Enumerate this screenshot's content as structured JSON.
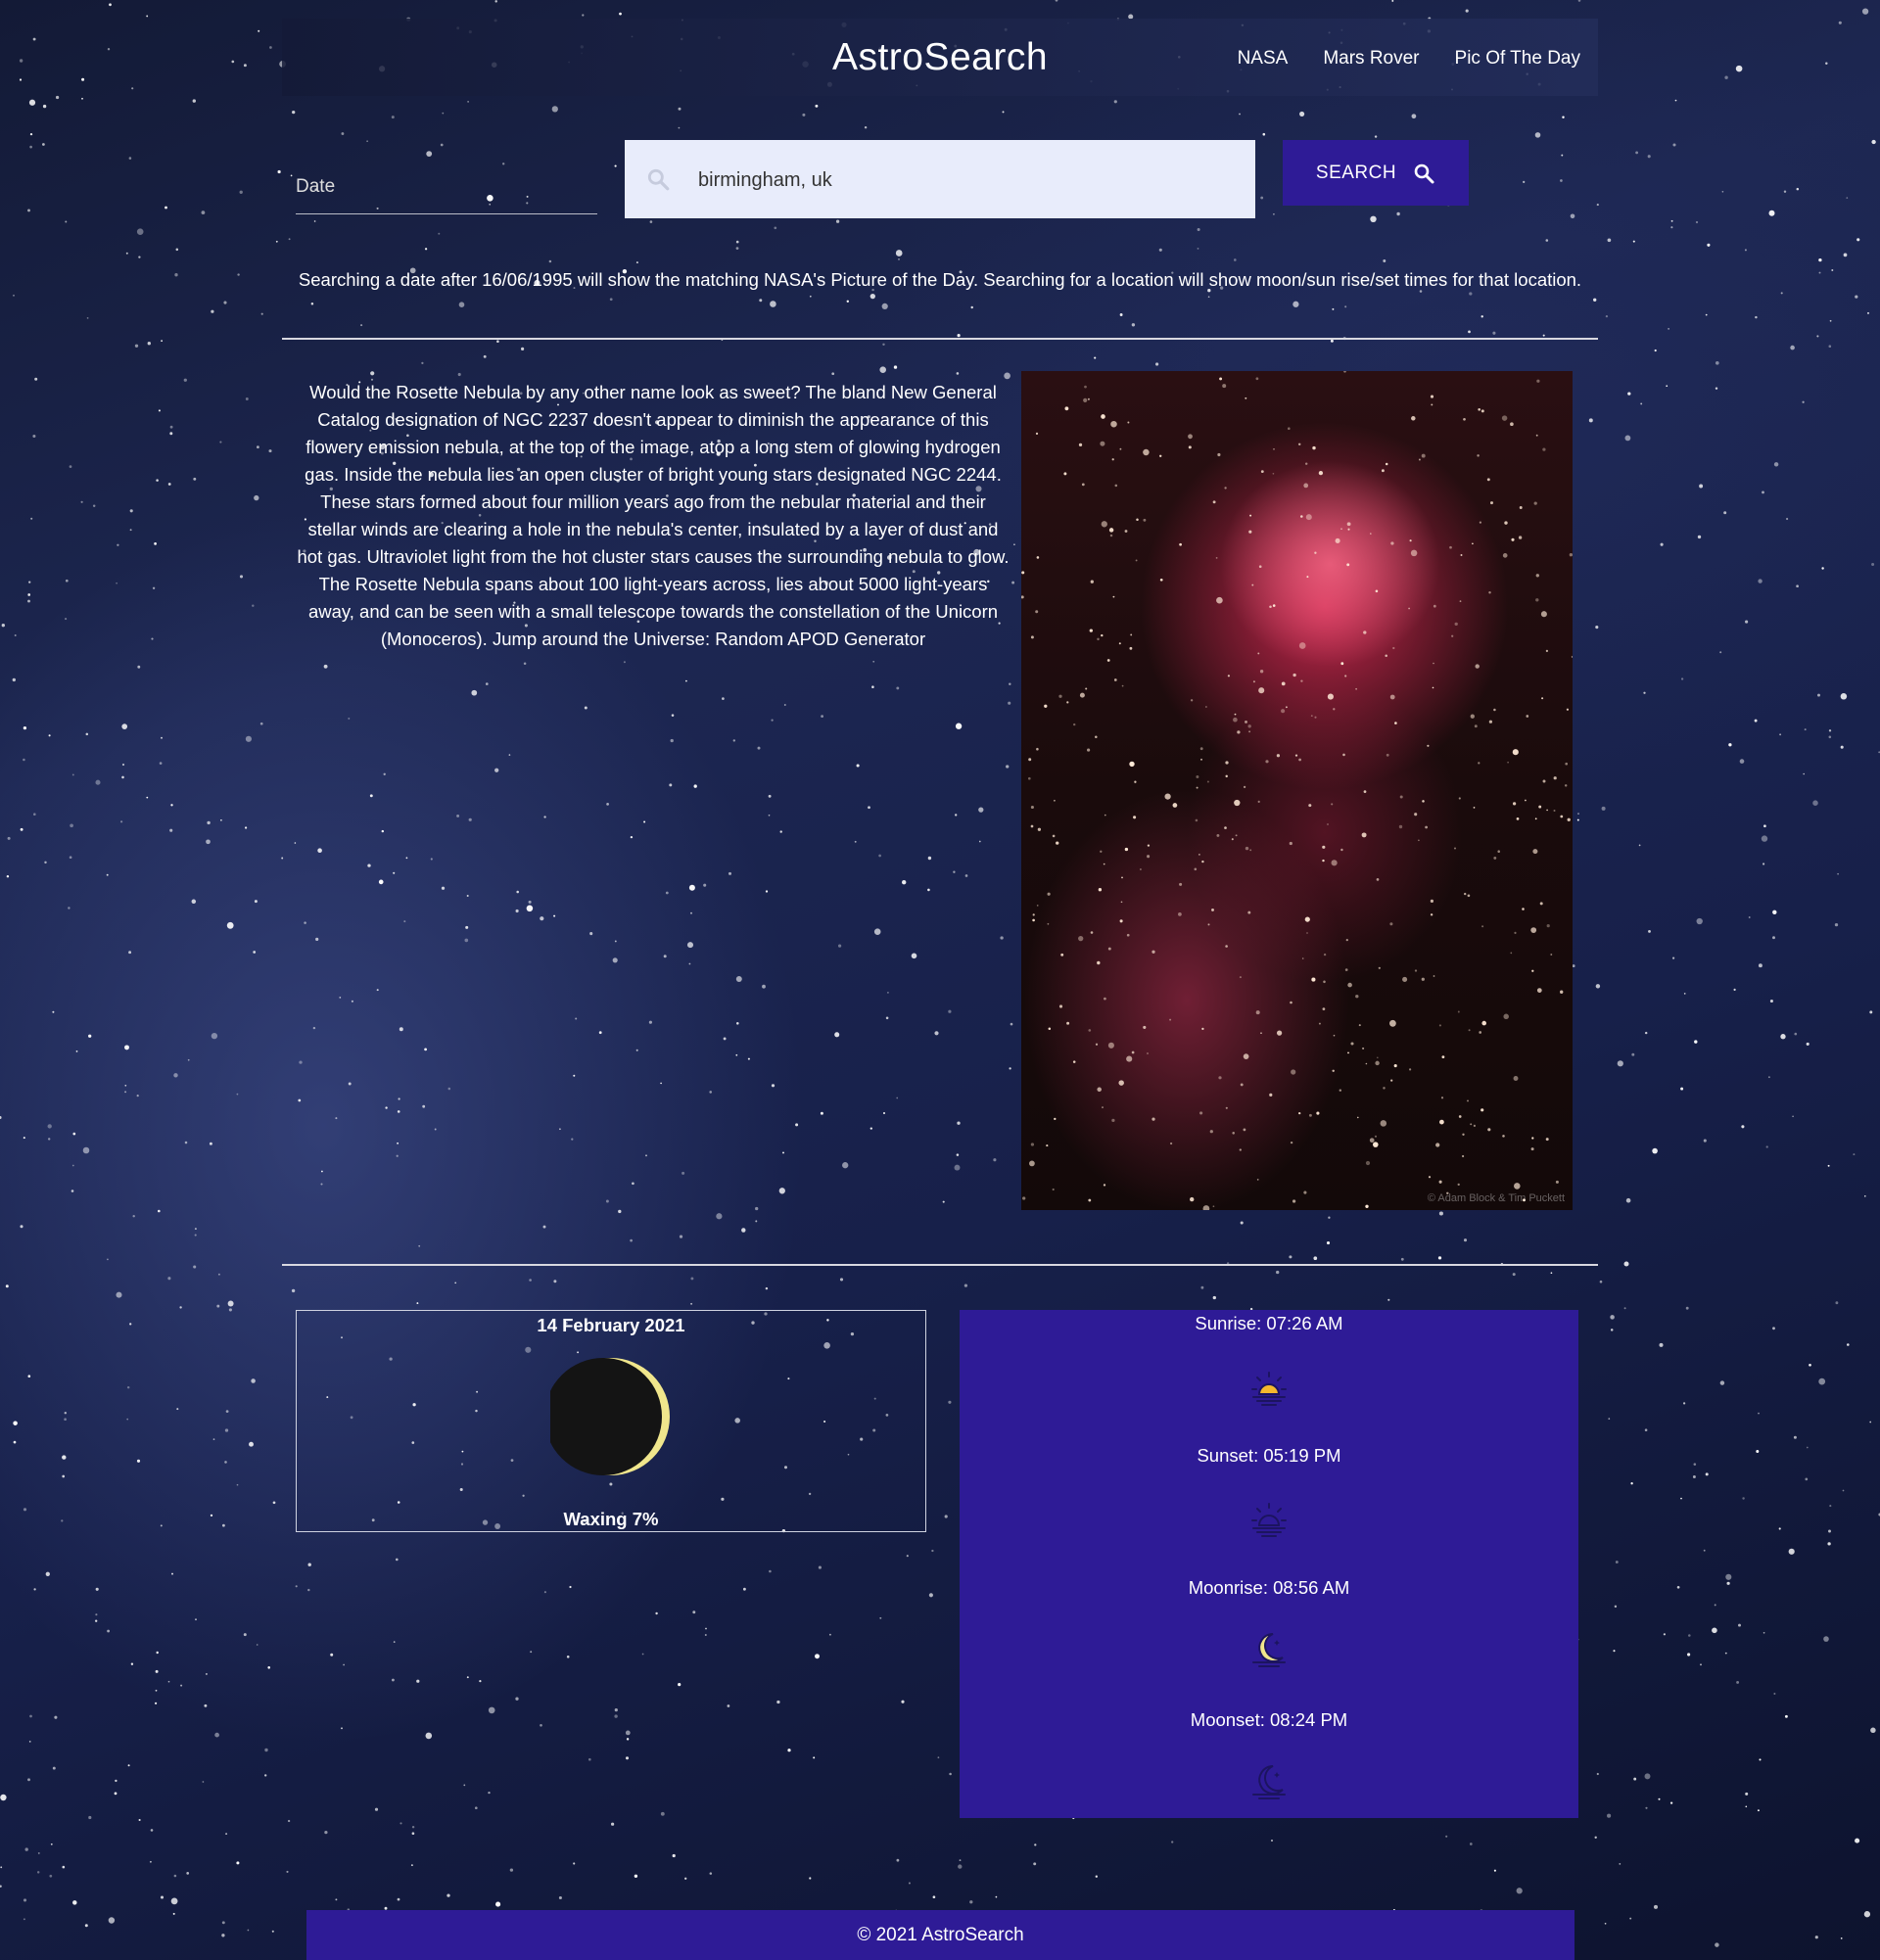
{
  "header": {
    "brand": "AstroSearch",
    "nav": [
      "NASA",
      "Mars Rover",
      "Pic Of The Day"
    ]
  },
  "search": {
    "date_placeholder": "Date",
    "location_value": "birmingham, uk",
    "button_label": "SEARCH"
  },
  "info_text": "Searching a date after 16/06/1995 will show the matching NASA's Picture of the Day. Searching for a location will show moon/sun rise/set times for that location.",
  "apod": {
    "description": "Would the Rosette Nebula by any other name look as sweet? The bland New General Catalog designation of NGC 2237 doesn't appear to diminish the appearance of this flowery emission nebula, at the top of the image, atop a long stem of glowing hydrogen gas. Inside the nebula lies an open cluster of bright young stars designated NGC 2244. These stars formed about four million years ago from the nebular material and their stellar winds are clearing a hole in the nebula's center, insulated by a layer of dust and hot gas. Ultraviolet light from the hot cluster stars causes the surrounding nebula to glow. The Rosette Nebula spans about 100 light-years across, lies about 5000 light-years away, and can be seen with a small telescope towards the constellation of the Unicorn (Monoceros). Jump around the Universe: Random APOD Generator",
    "image_credit": "© Adam Block & Tim Puckett"
  },
  "moon": {
    "date": "14 February 2021",
    "phase_label": "Waxing 7%",
    "illumination": 0.07
  },
  "times": {
    "sunrise": "Sunrise: 07:26 AM",
    "sunset": "Sunset: 05:19 PM",
    "moonrise": "Moonrise: 08:56 AM",
    "moonset": "Moonset: 08:24 PM"
  },
  "footer": "© 2021 AstroSearch",
  "colors": {
    "accent": "#2e1b96",
    "sun": "#f5b82e",
    "moon": "#f0e68c"
  }
}
